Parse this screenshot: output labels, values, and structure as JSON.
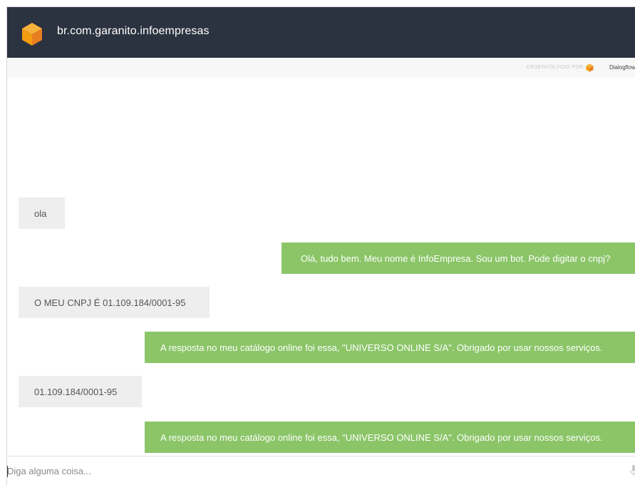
{
  "header": {
    "title": "br.com.garanito.infoempresas",
    "logo_icon": "cube-logo-icon",
    "background": "#2b3240",
    "accent": "#f39c12"
  },
  "powered_by": {
    "label": "DESENVOLVIDO POR",
    "brand": "Dialogflow"
  },
  "messages": [
    {
      "from": "user",
      "text": "ola"
    },
    {
      "from": "bot",
      "text": "Olá, tudo bem. Meu nome é InfoEmpresa. Sou um bot. Pode digitar o cnpj?"
    },
    {
      "from": "user",
      "text": "O MEU CNPJ É 01.109.184/0001-95"
    },
    {
      "from": "bot",
      "text": "A resposta no meu catálogo online foi essa, \"UNIVERSO ONLINE S/A\". Obrigado por usar nossos serviços."
    },
    {
      "from": "user",
      "text": "01.109.184/0001-95"
    },
    {
      "from": "bot",
      "text": "A resposta no meu catálogo online foi essa, \"UNIVERSO ONLINE S/A\". Obrigado por usar nossos serviços."
    }
  ],
  "colors": {
    "user_bubble": "#eeeeee",
    "bot_bubble": "#8bc568"
  },
  "input": {
    "placeholder": "Diga alguma coisa...",
    "value": "",
    "mic_icon": "microphone-icon"
  }
}
